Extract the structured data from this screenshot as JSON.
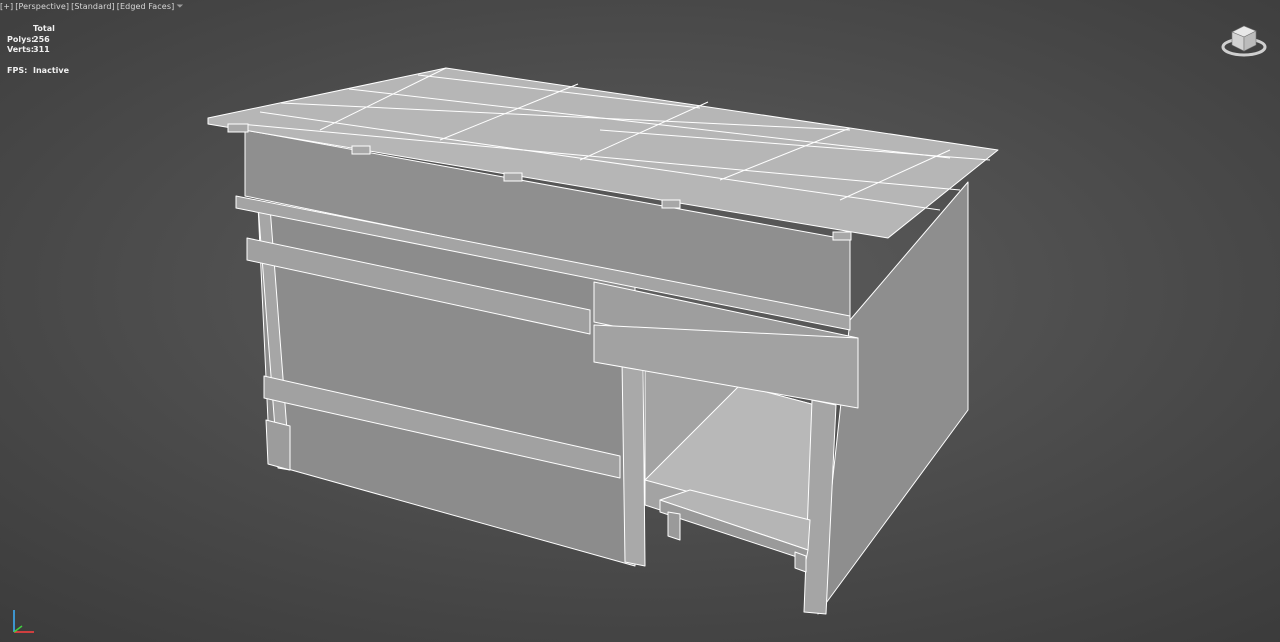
{
  "viewport": {
    "labels": [
      "[+]",
      "[Perspective]",
      "[Standard]",
      "[Edged Faces]"
    ],
    "filter_icon": "funnel-icon"
  },
  "stats": {
    "header": "Total",
    "polys_label": "Polys:",
    "polys_value": "256",
    "verts_label": "Verts:",
    "verts_value": "311",
    "fps_label": "FPS:",
    "fps_value": "Inactive"
  },
  "colors": {
    "face_front": "#8a8a8a",
    "face_roof": "#b9b9b9",
    "face_side": "#9a9a9a",
    "edge": "#ffffff"
  }
}
